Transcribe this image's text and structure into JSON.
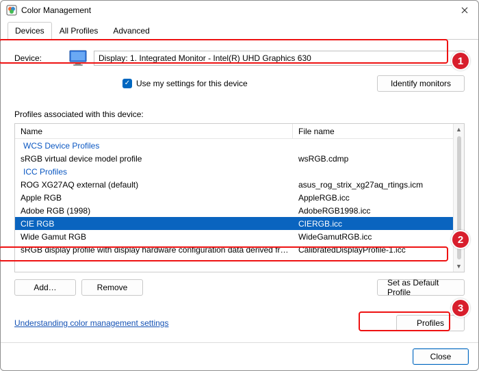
{
  "window": {
    "title": "Color Management"
  },
  "tabs": [
    "Devices",
    "All Profiles",
    "Advanced"
  ],
  "active_tab": 0,
  "device": {
    "label": "Device:",
    "selected": "Display: 1. Integrated Monitor - Intel(R) UHD Graphics 630"
  },
  "use_settings": {
    "checked": true,
    "label": "Use my settings for this device"
  },
  "identify_label": "Identify monitors",
  "profiles_section_label": "Profiles associated with this device:",
  "columns": {
    "name": "Name",
    "filename": "File name"
  },
  "profile_rows": [
    {
      "type": "group",
      "name": "WCS Device Profiles",
      "file": ""
    },
    {
      "type": "item",
      "name": "sRGB virtual device model profile",
      "file": "wsRGB.cdmp"
    },
    {
      "type": "group",
      "name": "ICC Profiles",
      "file": ""
    },
    {
      "type": "item",
      "name": "ROG XG27AQ external (default)",
      "file": "asus_rog_strix_xg27aq_rtings.icm"
    },
    {
      "type": "item",
      "name": "Apple RGB",
      "file": "AppleRGB.icc"
    },
    {
      "type": "item",
      "name": "Adobe RGB (1998)",
      "file": "AdobeRGB1998.icc"
    },
    {
      "type": "item",
      "name": "CIE RGB",
      "file": "CIERGB.icc",
      "selected": true
    },
    {
      "type": "item",
      "name": "Wide Gamut RGB",
      "file": "WideGamutRGB.icc"
    },
    {
      "type": "item",
      "name": "sRGB display profile with display hardware configuration data derived from cali...",
      "file": "CalibratedDisplayProfile-1.icc"
    }
  ],
  "buttons": {
    "add": "Add…",
    "remove": "Remove",
    "set_default": "Set as Default Profile",
    "profiles": "Profiles",
    "close": "Close"
  },
  "link": "Understanding color management settings",
  "annotations": {
    "1": "1",
    "2": "2",
    "3": "3"
  }
}
